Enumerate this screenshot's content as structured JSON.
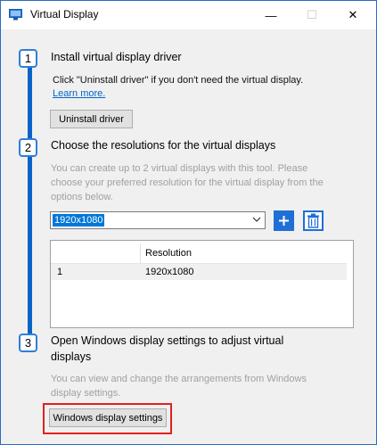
{
  "window": {
    "title": "Virtual Display",
    "controls": {
      "minimize": "—",
      "maximize": "☐",
      "close": "✕"
    }
  },
  "step1": {
    "number": "1",
    "heading": "Install virtual display driver",
    "description": "Click \"Uninstall driver\" if you don't need the virtual display.",
    "learn_more": "Learn more.",
    "button_label": "Uninstall driver"
  },
  "step2": {
    "number": "2",
    "heading": "Choose the resolutions for the virtual displays",
    "description_line1": "You can create up to 2 virtual displays with this tool.  Please",
    "description_line2": "choose your preferred resolution for the virtual display from the",
    "description_line3": "options below.",
    "resolution_selected": "1920x1080",
    "table": {
      "columns": [
        "",
        "Resolution"
      ],
      "rows": [
        {
          "index": "1",
          "resolution": "1920x1080"
        }
      ]
    }
  },
  "step3": {
    "number": "3",
    "heading_line1": "Open Windows display settings to adjust virtual",
    "heading_line2": "displays",
    "description_line1": "You can view and change the arrangements from Windows",
    "description_line2": "display settings.",
    "button_label": "Windows display settings"
  },
  "colors": {
    "accent": "#1f6fd6",
    "rail": "#0a63c9",
    "highlight": "#e02020",
    "link": "#0066cc"
  }
}
